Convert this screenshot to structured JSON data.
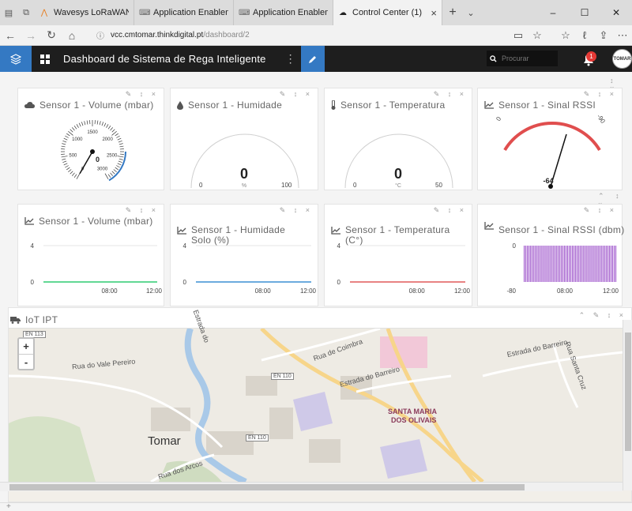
{
  "browser": {
    "tabs": [
      {
        "label": "Wavesys LoRaWAN Server",
        "icon": "lora-icon"
      },
      {
        "label": "Application Enablement Pla",
        "icon": "keyboard-icon"
      },
      {
        "label": "Application Enablement Pla",
        "icon": "keyboard-icon"
      },
      {
        "label": "Control Center (1)",
        "icon": "cloud-icon",
        "active": true
      }
    ],
    "url_host": "vcc.cmtomar.thinkdigital.pt",
    "url_path": "/dashboard/2",
    "new_tab": "+",
    "window_controls": [
      "–",
      "☐",
      "✕"
    ]
  },
  "app": {
    "title": "Dashboard de Sistema de Rega Inteligente",
    "search_placeholder": "Procurar",
    "notif_count": "1",
    "avatar_text": "TOMAR",
    "accent": "#3479c3"
  },
  "widgets": {
    "volume_gauge": {
      "title": "Sensor 1 - Volume (mbar)",
      "value": "0",
      "ticks": [
        "0",
        "500",
        "1000",
        "1500",
        "2000",
        "2500",
        "3000"
      ],
      "level": 0
    },
    "humidity_gauge": {
      "title": "Sensor 1 - Humidade",
      "value": "0",
      "unit": "%",
      "min": "0",
      "max": "100",
      "level": 0
    },
    "temp_gauge": {
      "title": "Sensor 1 - Temperatura",
      "value": "0",
      "unit": "°C",
      "min": "0",
      "max": "50",
      "level": 0
    },
    "rssi_gauge": {
      "title": "Sensor 1 - Sinal RSSI",
      "value": "-64",
      "min": "0",
      "max": "-90"
    }
  },
  "chart_data": [
    {
      "type": "line",
      "title": "Sensor 1 - Volume (mbar)",
      "y_ticks": [
        "4",
        "0"
      ],
      "x_ticks": [
        "08:00",
        "12:00"
      ],
      "series": [
        {
          "values": [
            0,
            0
          ]
        }
      ],
      "color": "#2ecc71"
    },
    {
      "type": "line",
      "title": "Sensor 1 - Humidade Solo (%)",
      "y_ticks": [
        "4",
        "0"
      ],
      "x_ticks": [
        "08:00",
        "12:00"
      ],
      "series": [
        {
          "values": [
            0,
            0
          ]
        }
      ],
      "color": "#3b8fd4"
    },
    {
      "type": "line",
      "title": "Sensor 1 - Temperatura (C°)",
      "y_ticks": [
        "4",
        "0"
      ],
      "x_ticks": [
        "08:00",
        "12:00"
      ],
      "series": [
        {
          "values": [
            0,
            0
          ]
        }
      ],
      "color": "#e05a5a"
    },
    {
      "type": "bar",
      "title": "Sensor 1 - Sinal RSSI (dbm)",
      "y_ticks": [
        "0",
        "-80"
      ],
      "x_ticks": [
        "08:00",
        "12:00"
      ],
      "ylim": [
        -80,
        0
      ],
      "color": "#9b4fc9"
    }
  ],
  "map": {
    "title": "IoT IPT",
    "zoom_in": "+",
    "zoom_out": "-",
    "labels": {
      "en113": "EN 113",
      "rua_coimbra": "Rua de Coimbra",
      "rua_vale": "Rua do Vale Pereiro",
      "en110_a": "EN 110",
      "en110_b": "EN 110",
      "estrada_barreiro": "Estrada do Barreiro",
      "estrada_barreiro2": "Estrada do Barreiro",
      "rua_santa_cruz": "Rua Santa Cruz",
      "santa_maria": "SANTA MARIA",
      "dos_olivais": "DOS OLIVAIS",
      "tomar": "Tomar",
      "rua_arcos": "Rua dos Arcos",
      "estrada_do": "Estrada do"
    }
  },
  "status": "+"
}
